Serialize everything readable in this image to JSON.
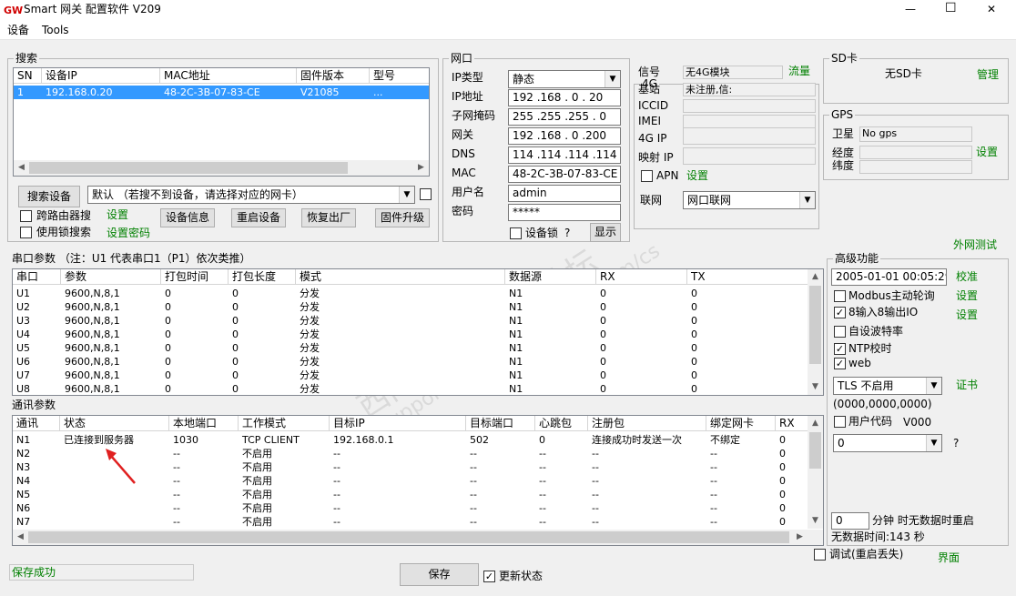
{
  "titlebar": {
    "logo": "GW",
    "title": "Smart 网关 配置软件 V209",
    "min": "—",
    "max": "☐",
    "close": "✕"
  },
  "menu": [
    "设备",
    "Tools"
  ],
  "search": {
    "title": "搜索",
    "columns": [
      "SN",
      "设备IP",
      "MAC地址",
      "固件版本",
      "型号"
    ],
    "rows": [
      [
        "1",
        "192.168.0.20",
        "48-2C-3B-07-83-CE",
        "V21085",
        "..."
      ]
    ],
    "search_button": "搜索设备",
    "nic_select": "默认 （若搜不到设备，请选择对应的网卡）",
    "cross_router": "跨路由器搜",
    "settings": "设置",
    "lock_search": "使用锁搜索",
    "set_password": "设置密码",
    "buttons": [
      "设备信息",
      "重启设备",
      "恢复出厂",
      "固件升级"
    ]
  },
  "network": {
    "title": "网口",
    "ip_type_label": "IP类型",
    "ip_type": "静态",
    "ip_label": "IP地址",
    "ip": "192 .168 . 0 . 20",
    "mask_label": "子网掩码",
    "mask": "255 .255 .255 . 0",
    "gw_label": "网关",
    "gw": "192 .168 . 0 .200",
    "dns_label": "DNS",
    "dns": "114 .114 .114 .114",
    "mac_label": "MAC",
    "mac": "48-2C-3B-07-83-CE",
    "user_label": "用户名",
    "user": "admin",
    "pass_label": "密码",
    "pass": "*****",
    "device_lock": "设备锁",
    "q": "?",
    "show": "显示"
  },
  "g4": {
    "title": "4G",
    "signal_label": "信号",
    "signal": "无4G模块",
    "traffic": "流量",
    "station_label": "基站",
    "station": "未注册,信:",
    "iccid_label": "ICCID",
    "imei_label": "IMEI",
    "ip_label": "4G IP",
    "map_label": "映射 IP",
    "apn": "APN",
    "apn_settings": "设置",
    "net_label": "联网",
    "net": "网口联网"
  },
  "sd": {
    "title": "SD卡",
    "status": "无SD卡",
    "manage": "管理"
  },
  "gps": {
    "title": "GPS",
    "sat_label": "卫星",
    "sat": "No gps",
    "lon_label": "经度",
    "lat_label": "纬度",
    "settings": "设置"
  },
  "ext_test": "外网测试",
  "serial": {
    "title": "串口参数 （注：U1 代表串口1（P1）依次类推）",
    "columns": [
      "串口",
      "参数",
      "打包时间",
      "打包长度",
      "模式",
      "数据源",
      "RX",
      "TX"
    ],
    "rows": [
      [
        "U1",
        "9600,N,8,1",
        "0",
        "0",
        "分发",
        "N1",
        "0",
        "0"
      ],
      [
        "U2",
        "9600,N,8,1",
        "0",
        "0",
        "分发",
        "N1",
        "0",
        "0"
      ],
      [
        "U3",
        "9600,N,8,1",
        "0",
        "0",
        "分发",
        "N1",
        "0",
        "0"
      ],
      [
        "U4",
        "9600,N,8,1",
        "0",
        "0",
        "分发",
        "N1",
        "0",
        "0"
      ],
      [
        "U5",
        "9600,N,8,1",
        "0",
        "0",
        "分发",
        "N1",
        "0",
        "0"
      ],
      [
        "U6",
        "9600,N,8,1",
        "0",
        "0",
        "分发",
        "N1",
        "0",
        "0"
      ],
      [
        "U7",
        "9600,N,8,1",
        "0",
        "0",
        "分发",
        "N1",
        "0",
        "0"
      ],
      [
        "U8",
        "9600,N,8,1",
        "0",
        "0",
        "分发",
        "N1",
        "0",
        "0"
      ]
    ]
  },
  "comm": {
    "title": "通讯参数",
    "columns": [
      "通讯",
      "状态",
      "本地端口",
      "工作模式",
      "目标IP",
      "目标端口",
      "心跳包",
      "注册包",
      "绑定网卡",
      "RX"
    ],
    "rows": [
      [
        "N1",
        "已连接到服务器",
        "1030",
        "TCP CLIENT",
        "192.168.0.1",
        "502",
        "0",
        "连接成功时发送一次",
        "不绑定",
        "0"
      ],
      [
        "N2",
        "",
        "--",
        "不启用",
        "--",
        "--",
        "--",
        "--",
        "--",
        "0"
      ],
      [
        "N3",
        "",
        "--",
        "不启用",
        "--",
        "--",
        "--",
        "--",
        "--",
        "0"
      ],
      [
        "N4",
        "",
        "--",
        "不启用",
        "--",
        "--",
        "--",
        "--",
        "--",
        "0"
      ],
      [
        "N5",
        "",
        "--",
        "不启用",
        "--",
        "--",
        "--",
        "--",
        "--",
        "0"
      ],
      [
        "N6",
        "",
        "--",
        "不启用",
        "--",
        "--",
        "--",
        "--",
        "--",
        "0"
      ],
      [
        "N7",
        "",
        "--",
        "不启用",
        "--",
        "--",
        "--",
        "--",
        "--",
        "0"
      ]
    ]
  },
  "advanced": {
    "title": "高级功能",
    "time": "2005-01-01 00:05:29",
    "calibrate": "校准",
    "modbus": "Modbus主动轮询",
    "modbus_set": "设置",
    "io": "8输入8输出IO",
    "io_set": "设置",
    "baud": "自设波特率",
    "ntp": "NTP校时",
    "web": "web",
    "tls": "TLS 不启用",
    "cert": "证书",
    "tls_code": "(0000,0000,0000)",
    "user_code": "用户代码",
    "user_code_val": "V000",
    "code_sel": "0",
    "code_q": "?",
    "reboot_min": "0",
    "reboot_text": "分钟 时无数据时重启",
    "nodata": "无数据时间:143 秒",
    "debug": "调试(重启丢失)",
    "ui": "界面"
  },
  "status": {
    "text": "保存成功",
    "save": "保存",
    "update": "更新状态"
  },
  "watermark": {
    "cn": "西门子工业技术论坛",
    "en": "support.industry.siemens.com/cs"
  }
}
